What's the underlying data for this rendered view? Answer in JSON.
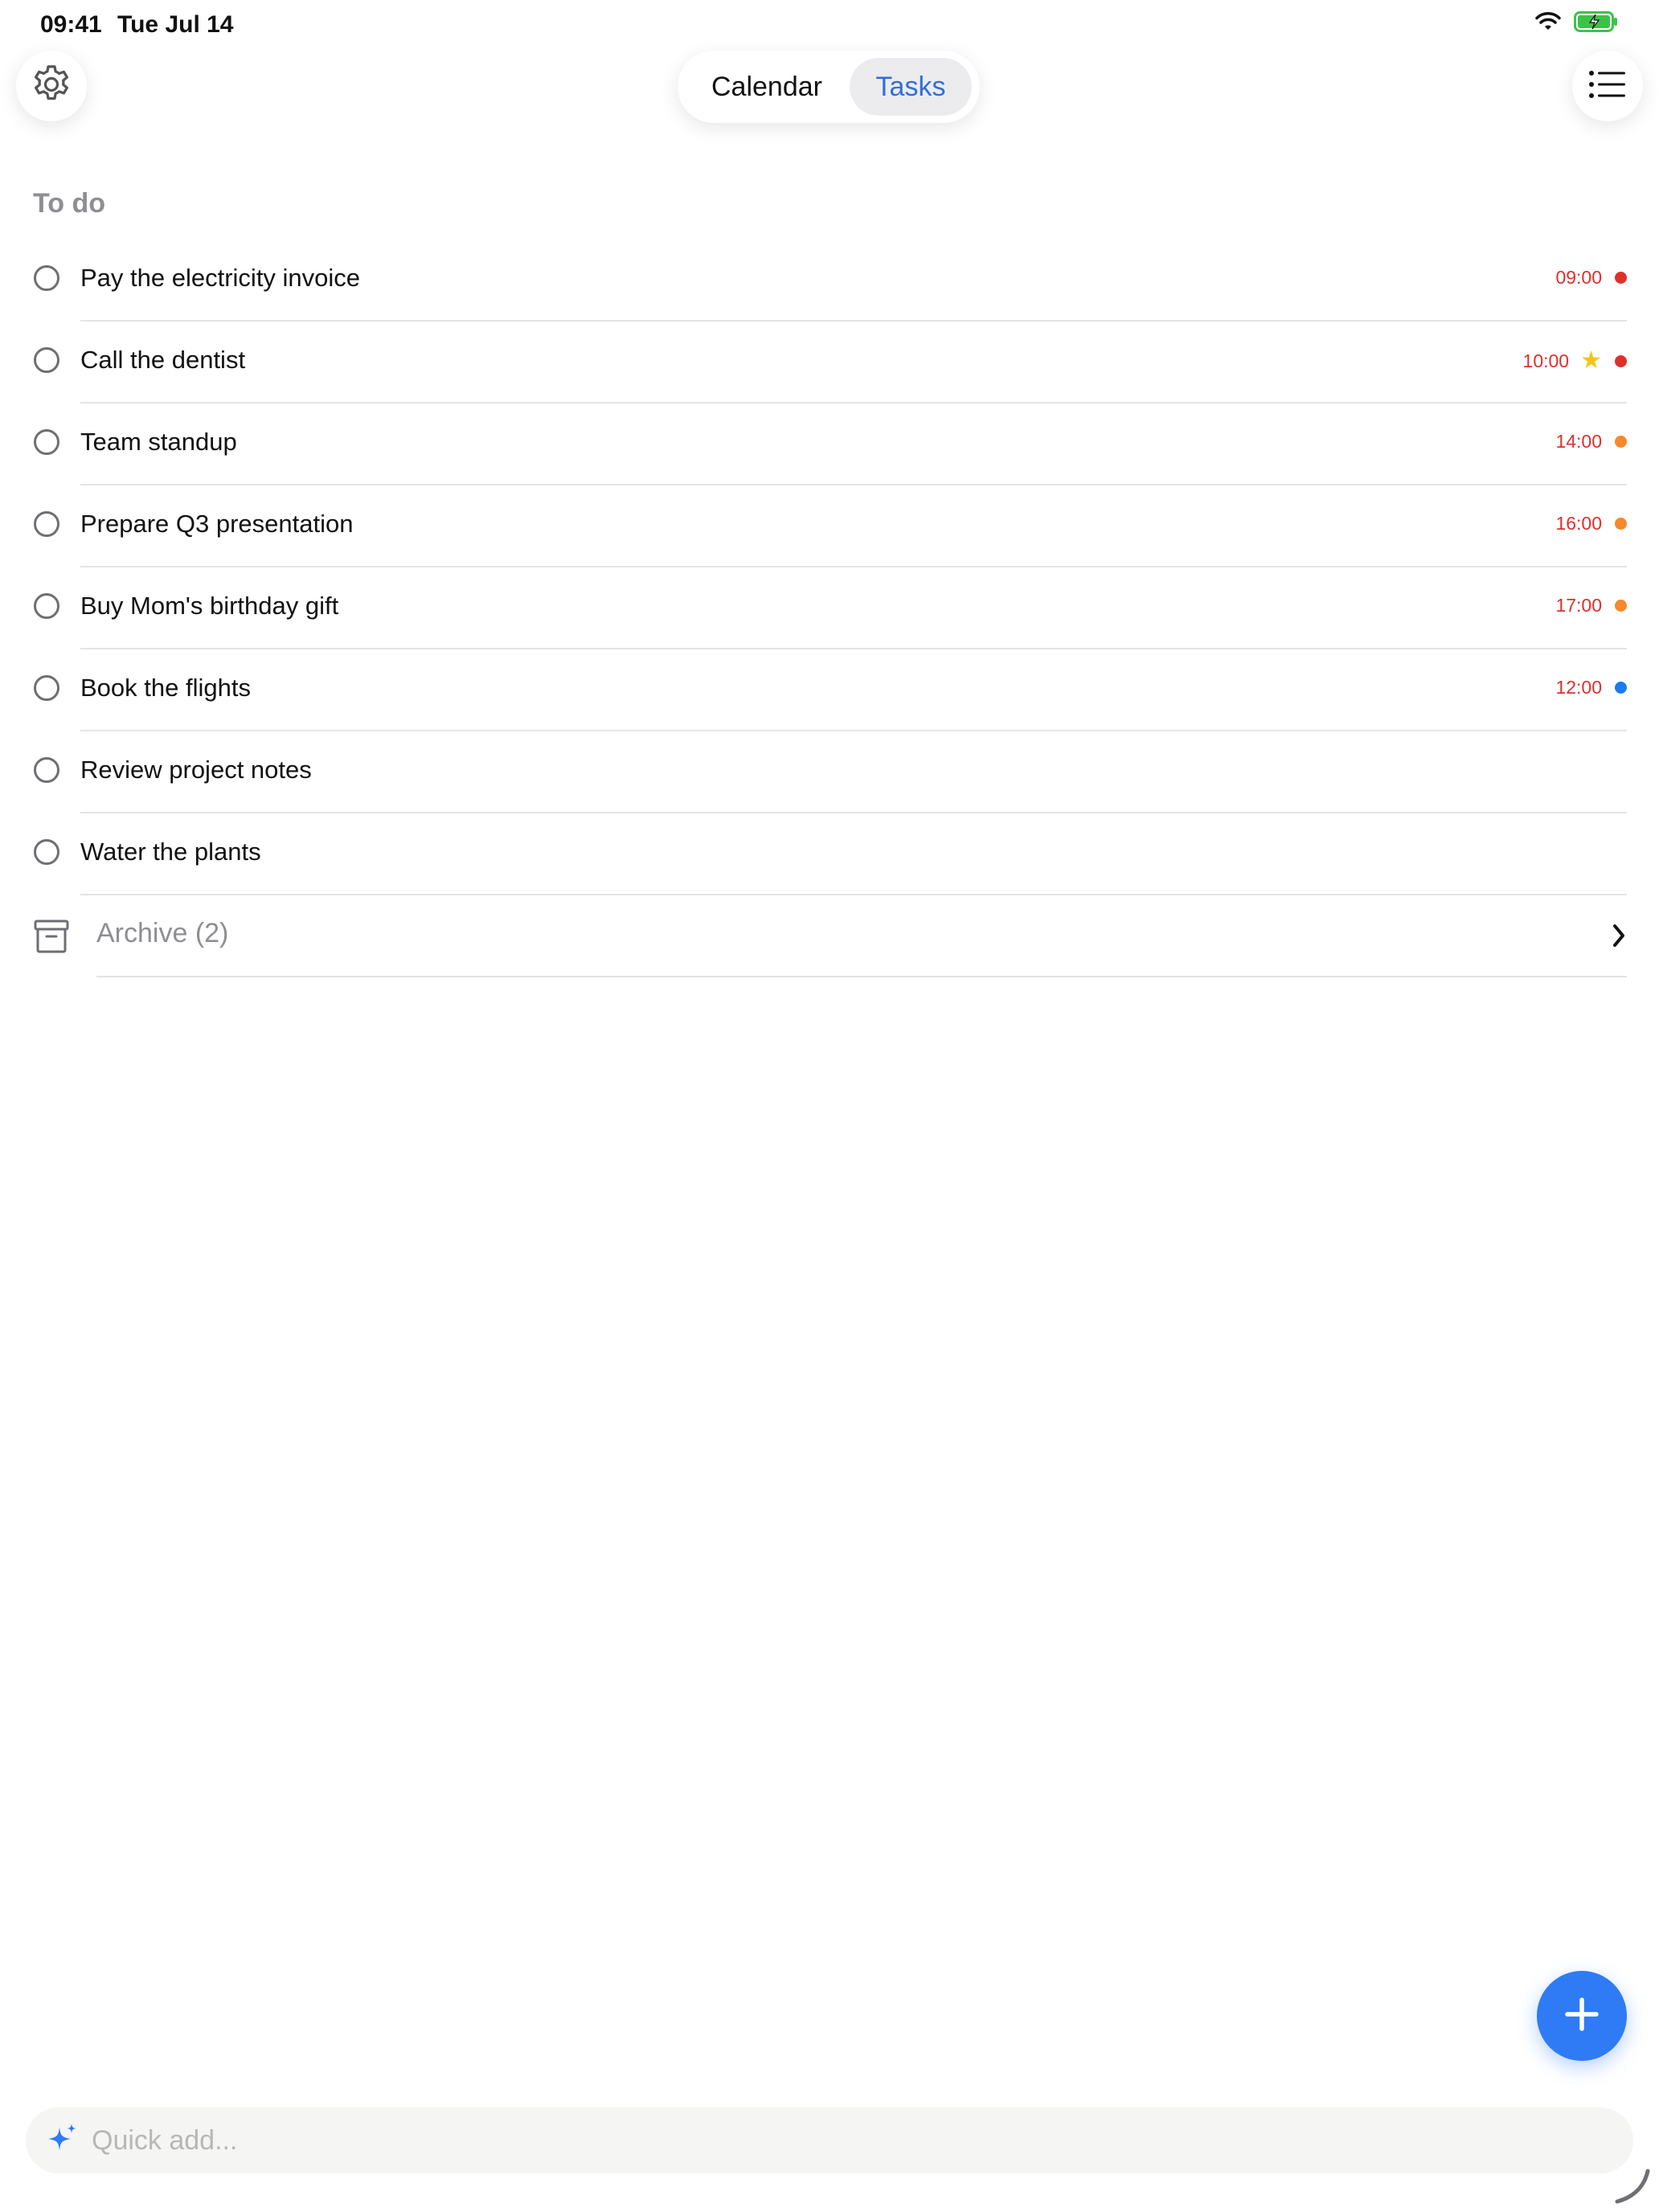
{
  "status_bar": {
    "time": "09:41",
    "date": "Tue Jul 14",
    "icons": [
      "wifi-icon",
      "battery-charging-icon"
    ]
  },
  "header": {
    "tabs": [
      {
        "label": "Calendar",
        "selected": false
      },
      {
        "label": "Tasks",
        "selected": true
      }
    ],
    "icons": [
      "gear-icon",
      "list-icon"
    ]
  },
  "section": {
    "title": "To do"
  },
  "tasks": [
    {
      "title": "Pay the electricity invoice",
      "time": "09:00",
      "starred": false,
      "priority_color": "#e0302c"
    },
    {
      "title": "Call the dentist",
      "time": "10:00",
      "starred": true,
      "priority_color": "#e0302c"
    },
    {
      "title": "Team standup",
      "time": "14:00",
      "starred": false,
      "priority_color": "#f5892b"
    },
    {
      "title": "Prepare Q3 presentation",
      "time": "16:00",
      "starred": false,
      "priority_color": "#f5892b"
    },
    {
      "title": "Buy Mom's birthday gift",
      "time": "17:00",
      "starred": false,
      "priority_color": "#f5892b"
    },
    {
      "title": "Book the flights",
      "time": "12:00",
      "starred": false,
      "priority_color": "#1a7cf2"
    },
    {
      "title": "Review project notes",
      "time": "",
      "starred": false,
      "priority_color": ""
    },
    {
      "title": "Water the plants",
      "time": "",
      "starred": false,
      "priority_color": ""
    }
  ],
  "archive": {
    "label": "Archive (2)"
  },
  "quick_add": {
    "placeholder": "Quick add..."
  },
  "colors": {
    "accent": "#2f7bf5",
    "tab_selected_text": "#2f6fd8",
    "time_text": "#e0302c",
    "star": "#f5c518"
  }
}
